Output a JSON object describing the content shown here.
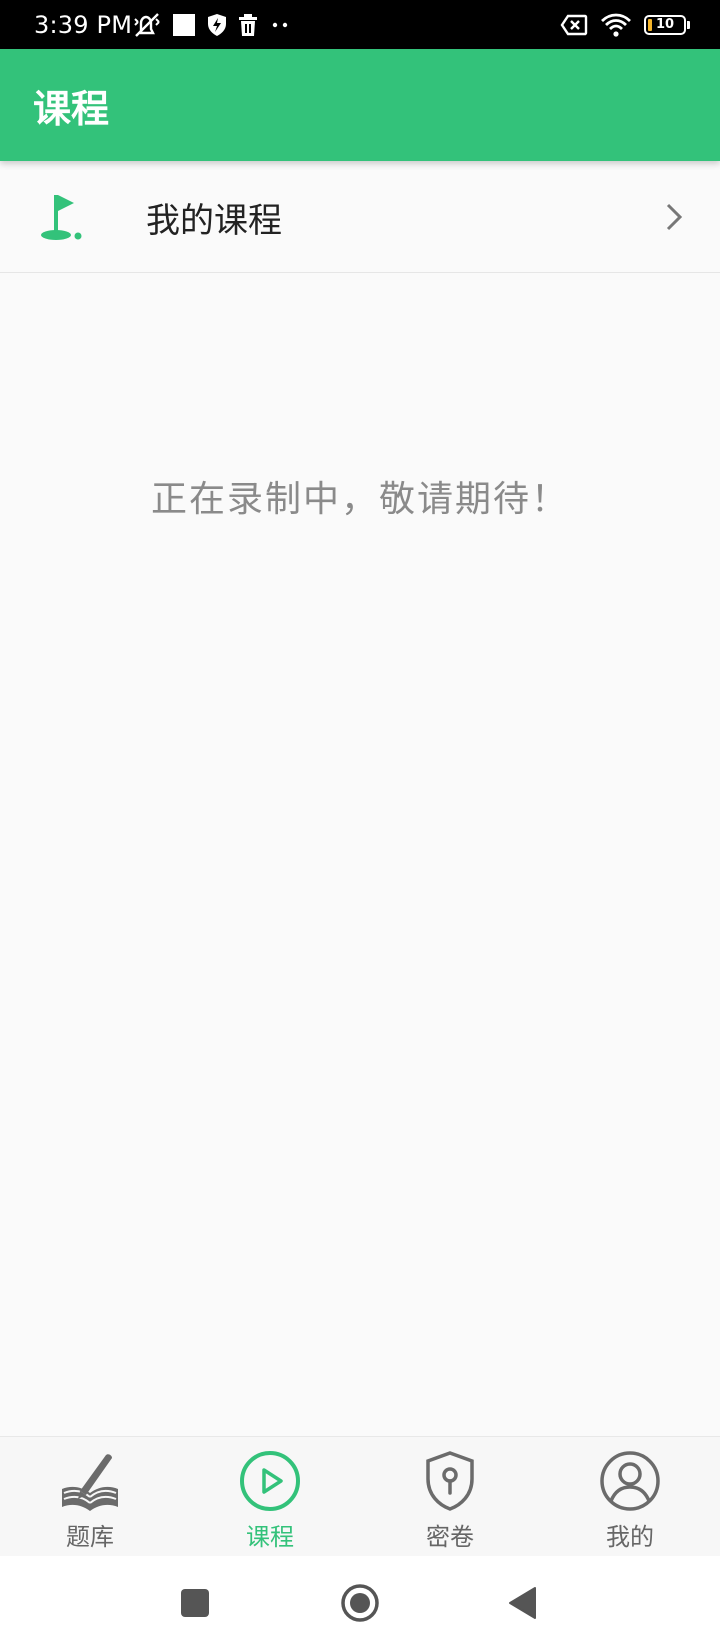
{
  "status_bar": {
    "time": "3:39 PM",
    "battery_level": "10",
    "icons_left": [
      "mute-vibrate-icon",
      "square-notification-icon",
      "shield-bolt-icon",
      "trash-icon",
      "more-dots-icon"
    ],
    "icons_right": [
      "no-sim-icon",
      "wifi-icon",
      "battery-icon"
    ]
  },
  "app_bar": {
    "title": "课程"
  },
  "course_row": {
    "label": "我的课程"
  },
  "content": {
    "empty_message": "正在录制中，敬请期待！"
  },
  "bottom_nav": {
    "items": [
      {
        "label": "题库",
        "icon": "book-pencil-icon"
      },
      {
        "label": "课程",
        "icon": "play-circle-icon",
        "active": true
      },
      {
        "label": "密卷",
        "icon": "shield-keyhole-icon"
      },
      {
        "label": "我的",
        "icon": "user-circle-icon"
      }
    ]
  },
  "colors": {
    "brand": "#33C27A",
    "status_bar": "#000000",
    "background": "#FAFAFA",
    "inactive_nav": "#666666"
  }
}
